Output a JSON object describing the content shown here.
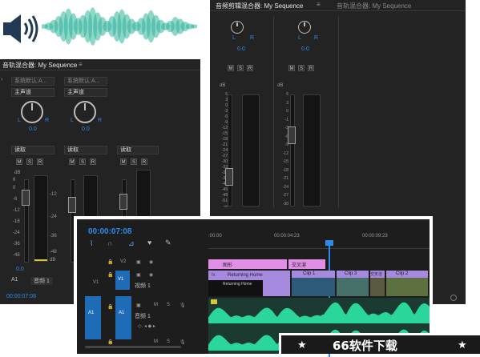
{
  "wave": {
    "color": "#2fb59a",
    "bars": [
      0.12,
      0.2,
      0.35,
      0.55,
      0.8,
      0.95,
      0.7,
      0.45,
      0.6,
      0.85,
      1.0,
      0.75,
      0.5,
      0.3,
      0.55,
      0.8,
      0.9,
      0.65,
      0.4,
      0.25,
      0.45,
      0.7,
      0.85,
      0.6,
      0.35,
      0.2,
      0.3,
      0.5,
      0.4,
      0.25,
      0.15,
      0.1
    ]
  },
  "left_mixer": {
    "title": "音轨混合器: My Sequence",
    "channels": [
      {
        "track": "系统默认:A...",
        "output": "主声道",
        "val": "0.0",
        "read": "读取",
        "L": "L",
        "R": "R"
      },
      {
        "track": "系统默认:A...",
        "output": "主声道",
        "val": "0.0",
        "read": "读取",
        "L": "L",
        "R": "R"
      },
      {
        "track": "",
        "output": "",
        "val": "",
        "read": "读取",
        "L": "",
        "R": ""
      }
    ],
    "buttons": [
      "M",
      "S",
      "R"
    ],
    "db_label": "dB",
    "scale": [
      "6",
      "0",
      "-6",
      "-12",
      "-18",
      "-24",
      "-36",
      "-48",
      "-∞"
    ],
    "scale2": [
      "-12",
      "-24",
      "-36",
      "-48"
    ],
    "bottom_val": "0.0",
    "track_a1": "A1",
    "track_name": "音频 1",
    "timecode": "00:00:07:08"
  },
  "right_mixer": {
    "tab1": "音频剪辑混合器: My Sequence",
    "tab2": "音轨混合器: My Sequence",
    "val": "0.0",
    "L": "L",
    "R": "R",
    "buttons": [
      "M",
      "S",
      "R"
    ],
    "db_label": "dB",
    "scale": [
      "6",
      "3",
      "0",
      "-3",
      "-6",
      "-9",
      "-12",
      "-15",
      "-18",
      "-21",
      "-24",
      "-27",
      "-30",
      "-33",
      "-36",
      "-39",
      "-42",
      "-45",
      "-48",
      "-51",
      "-∞"
    ],
    "scale_right": [
      "6",
      "3",
      "0",
      "-1",
      "-3",
      "-6",
      "-9",
      "-12",
      "-15",
      "-18",
      "-21",
      "-24",
      "-27",
      "-30"
    ]
  },
  "timeline": {
    "timecode": "00:00:07:08",
    "ruler": [
      ":00:00",
      "00:00:04:23",
      "00:00:09:23"
    ],
    "v2": "V2",
    "v1": "V1",
    "v1_src": "V1",
    "a1": "A1",
    "a1_src": "A1",
    "video_name": "视频 1",
    "audio_name": "音频 1",
    "clip_graphic": "图形",
    "clip_cross": "交叉溶",
    "clip_returning": "Returning Home",
    "clip_returning_small": "Returning Home",
    "clip1": "Clip 1",
    "clip3": "Clip 3",
    "clip2": "Clip 2",
    "clip_cross2": "交叉溶",
    "fx": "fx",
    "audio_color": "#2bd69a"
  },
  "watermark": {
    "text": "66软件下载",
    "star": "★"
  }
}
